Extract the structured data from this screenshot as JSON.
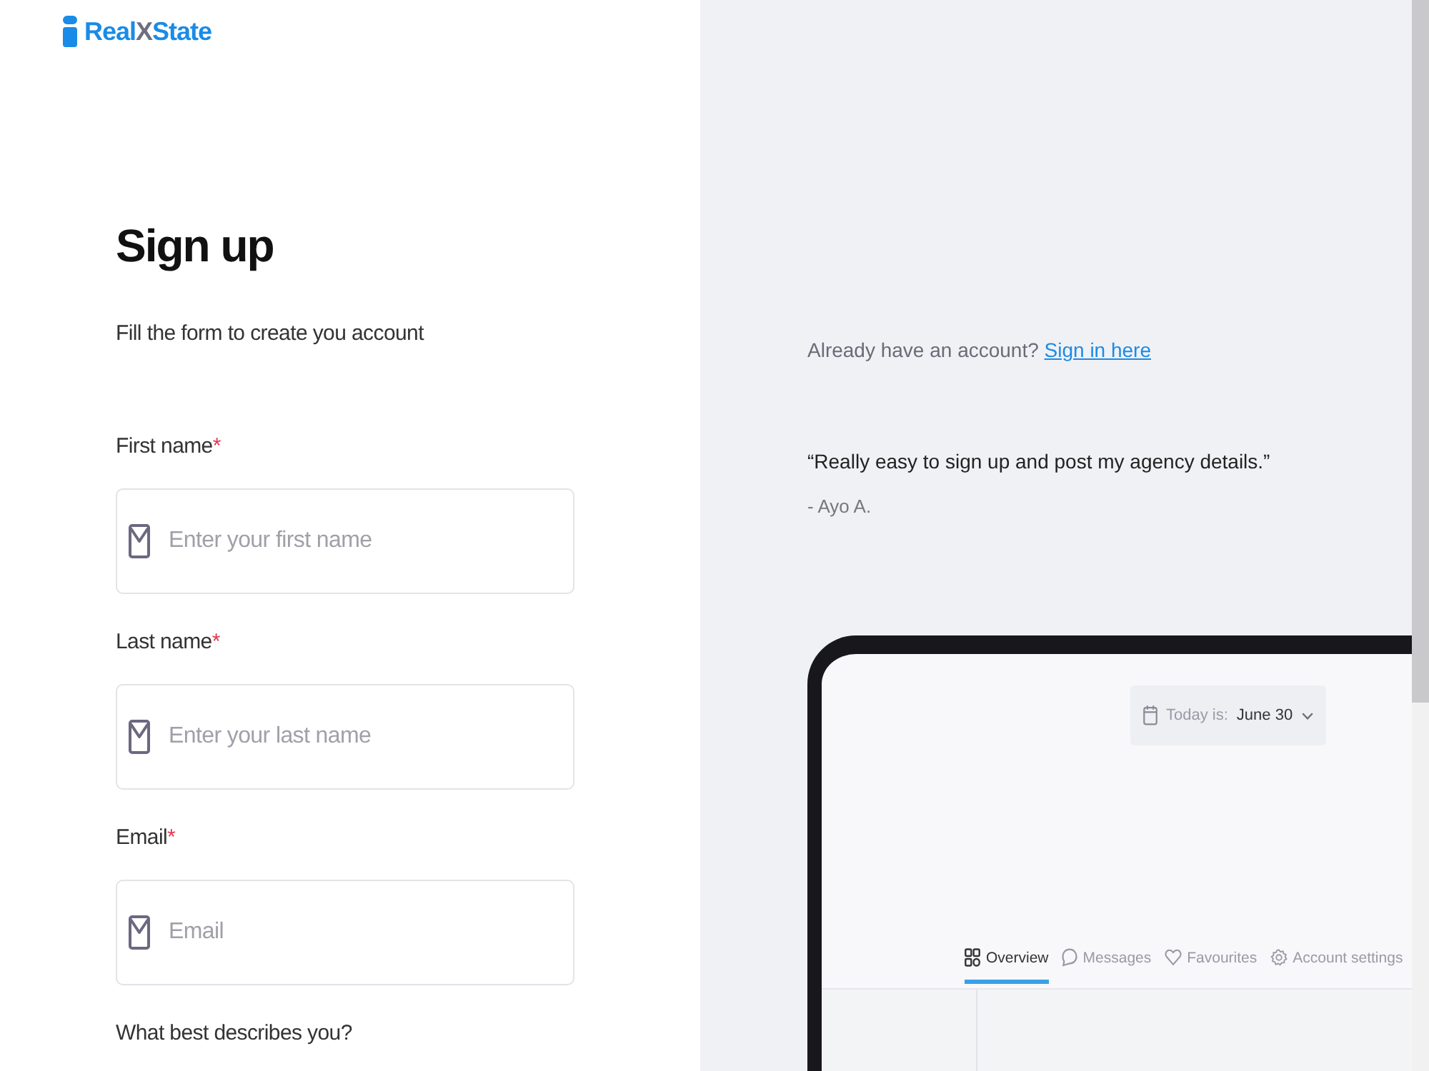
{
  "logo": {
    "parts": [
      {
        "text": "Real",
        "color": "#1a8be6"
      },
      {
        "text": "X",
        "color": "#6e6e82"
      },
      {
        "text": "State",
        "color": "#1a8be6"
      }
    ]
  },
  "form": {
    "title": "Sign up",
    "subtitle": "Fill the form to create you account",
    "fields": [
      {
        "label": "First name",
        "required_mark": "*",
        "placeholder": "Enter your first name"
      },
      {
        "label": "Last name",
        "required_mark": "*",
        "placeholder": "Enter your last name"
      },
      {
        "label": "Email",
        "required_mark": "*",
        "placeholder": "Email"
      }
    ],
    "question": "What best describes you?"
  },
  "aside": {
    "signin_prompt": "Already have an account?",
    "signin_link": "Sign in here",
    "quote": "“Really easy to sign up and post my agency details.”",
    "quote_author": "- Ayo A.",
    "mockup": {
      "date_label": "Today is:",
      "date_value": "June 30",
      "tabs": [
        {
          "label": "Overview",
          "selected": true
        },
        {
          "label": "Messages",
          "selected": false
        },
        {
          "label": "Favourites",
          "selected": false
        },
        {
          "label": "Account settings",
          "selected": false
        }
      ]
    }
  }
}
